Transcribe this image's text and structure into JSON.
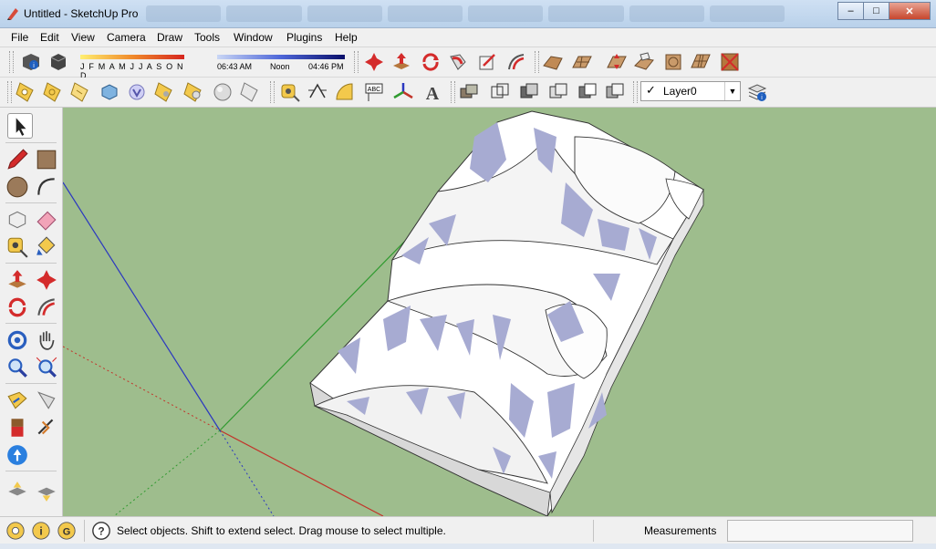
{
  "window": {
    "title": "Untitled - SketchUp Pro",
    "minimize": "–",
    "maximize": "□",
    "close": "✕"
  },
  "menu": [
    "File",
    "Edit",
    "View",
    "Camera",
    "Draw",
    "Tools",
    "Window",
    "Plugins",
    "Help"
  ],
  "shadows": {
    "months": "J F M A M J J A S O N D",
    "time_start": "06:43 AM",
    "time_noon": "Noon",
    "time_end": "04:46 PM"
  },
  "layers": {
    "current": "Layer0",
    "check": "✓"
  },
  "status": {
    "hint": "Select objects. Shift to extend select. Drag mouse to select multiple.",
    "measurements_label": "Measurements",
    "measurements_value": ""
  },
  "colors": {
    "viewport": "#9ebd8d",
    "axis_red": "#c2342a",
    "axis_green": "#2f9a2f",
    "axis_blue": "#2a37c0",
    "texture_blue": "#a7abd2"
  }
}
